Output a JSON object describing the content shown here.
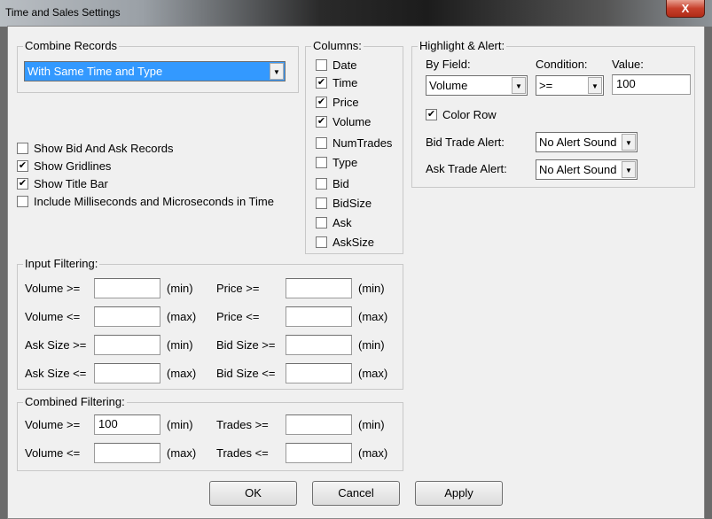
{
  "window": {
    "title": "Time and Sales Settings",
    "close": "X"
  },
  "combine": {
    "label": "Combine Records",
    "value": "With Same Time and Type"
  },
  "options": [
    {
      "label": "Show Bid And Ask Records",
      "checked": false
    },
    {
      "label": "Show Gridlines",
      "checked": true
    },
    {
      "label": "Show Title Bar",
      "checked": true
    },
    {
      "label": "Include Milliseconds and Microseconds in Time",
      "checked": false
    }
  ],
  "columns": {
    "label": "Columns:",
    "items": [
      {
        "label": "Date",
        "checked": false
      },
      {
        "label": "Time",
        "checked": true
      },
      {
        "label": "Price",
        "checked": true
      },
      {
        "label": "Volume",
        "checked": true
      },
      {
        "label": "NumTrades",
        "checked": false
      },
      {
        "label": "Type",
        "checked": false
      },
      {
        "label": "Bid",
        "checked": false
      },
      {
        "label": "BidSize",
        "checked": false
      },
      {
        "label": "Ask",
        "checked": false
      },
      {
        "label": "AskSize",
        "checked": false
      }
    ]
  },
  "highlight": {
    "label": "Highlight & Alert:",
    "by_field_label": "By Field:",
    "by_field": "Volume",
    "condition_label": "Condition:",
    "condition": ">=",
    "value_label": "Value:",
    "value": "100",
    "color_row": "Color Row",
    "color_row_checked": true,
    "bid_alert_label": "Bid Trade Alert:",
    "bid_alert": "No Alert Sound",
    "ask_alert_label": "Ask Trade Alert:",
    "ask_alert": "No Alert Sound"
  },
  "input_filtering": {
    "label": "Input Filtering:",
    "rows": [
      {
        "l1": "Volume >=",
        "v1": "",
        "s1": "(min)",
        "l2": "Price >=",
        "v2": "",
        "s2": "(min)"
      },
      {
        "l1": "Volume <=",
        "v1": "",
        "s1": "(max)",
        "l2": "Price <=",
        "v2": "",
        "s2": "(max)"
      },
      {
        "l1": "Ask Size >=",
        "v1": "",
        "s1": "(min)",
        "l2": "Bid Size >=",
        "v2": "",
        "s2": "(min)"
      },
      {
        "l1": "Ask Size <=",
        "v1": "",
        "s1": "(max)",
        "l2": "Bid Size <=",
        "v2": "",
        "s2": "(max)"
      }
    ]
  },
  "combined_filtering": {
    "label": "Combined Filtering:",
    "rows": [
      {
        "l1": "Volume >=",
        "v1": "100",
        "s1": "(min)",
        "l2": "Trades >=",
        "v2": "",
        "s2": "(min)"
      },
      {
        "l1": "Volume <=",
        "v1": "",
        "s1": "(max)",
        "l2": "Trades <=",
        "v2": "",
        "s2": "(max)"
      }
    ]
  },
  "buttons": {
    "ok": "OK",
    "cancel": "Cancel",
    "apply": "Apply"
  }
}
